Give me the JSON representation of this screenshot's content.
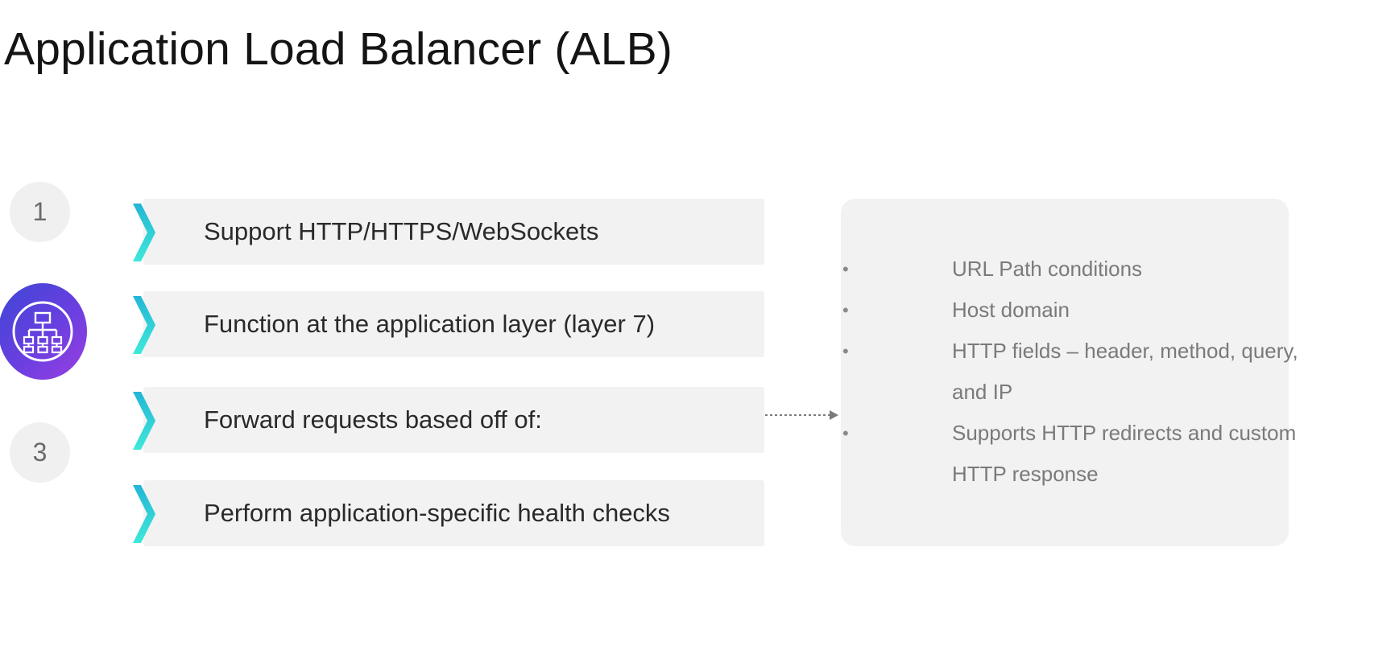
{
  "slide": {
    "title": "Application Load Balancer (ALB)"
  },
  "steps": [
    {
      "label": "1"
    },
    {
      "label": ""
    },
    {
      "label": "3"
    }
  ],
  "items": [
    {
      "text": "Support HTTP/HTTPS/WebSockets"
    },
    {
      "text": "Function at the application layer (layer 7)"
    },
    {
      "text": "Forward requests based off of:"
    },
    {
      "text": "Perform application-specific health checks"
    }
  ],
  "details": [
    {
      "text": "URL Path conditions"
    },
    {
      "text": "Host domain"
    },
    {
      "text": "HTTP fields – header, method, query, and IP"
    },
    {
      "text": "Supports HTTP redirects and custom HTTP response"
    }
  ],
  "icons": {
    "active_step": "network-hierarchy-icon",
    "item_marker": "chevron-right-icon",
    "connector": "dotted-arrow-icon"
  },
  "colors": {
    "chevron": "#2ad7dc",
    "active_gradient_start": "#3d46d6",
    "active_gradient_end": "#9b3fe0",
    "panel": "#f2f2f2"
  }
}
